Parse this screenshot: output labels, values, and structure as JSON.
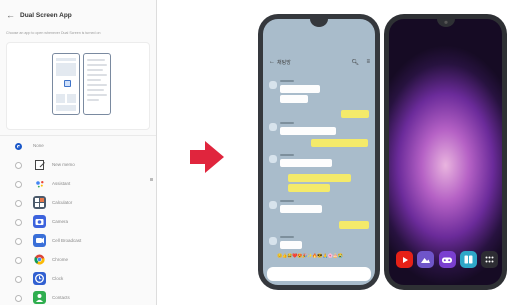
{
  "settings": {
    "title": "Dual Screen App",
    "description": "Choose an app to open whenever Dual Screen is turned on",
    "apps": [
      {
        "label": "None",
        "selected": true,
        "icon": "none",
        "color": ""
      },
      {
        "label": "New memo",
        "selected": false,
        "icon": "memo-icon",
        "color": "#ffffff"
      },
      {
        "label": "Assistant",
        "selected": false,
        "icon": "assistant-icon",
        "color": "#ffffff"
      },
      {
        "label": "Calculator",
        "selected": false,
        "icon": "calculator-icon",
        "color": "#4b5a6b"
      },
      {
        "label": "Camera",
        "selected": false,
        "icon": "camera-icon",
        "color": "#3d63dd"
      },
      {
        "label": "Cell Broadcast",
        "selected": false,
        "icon": "cell-broadcast-icon",
        "color": "#3a6fd8"
      },
      {
        "label": "Chrome",
        "selected": false,
        "icon": "chrome-icon",
        "color": "#ffffff"
      },
      {
        "label": "Clock",
        "selected": false,
        "icon": "clock-icon",
        "color": "#3160d1"
      },
      {
        "label": "Contacts",
        "selected": false,
        "icon": "contacts-icon",
        "color": "#2fae4f"
      }
    ]
  },
  "chat": {
    "title": "채팅방",
    "emoji_row": "😊👍😂❤️😍🎉✨🔥😎🙏🌸🎂😭"
  },
  "dock": [
    {
      "name": "youtube-icon",
      "color": "#e62117"
    },
    {
      "name": "gallery-icon",
      "color": "#6f55c9"
    },
    {
      "name": "game-icon",
      "color": "#7a3fd0"
    },
    {
      "name": "dual-screen-icon",
      "color": "#2ea7c8"
    },
    {
      "name": "apps-grid-icon",
      "color": "#2d2d33"
    }
  ],
  "arrow_color": "#e0253d"
}
